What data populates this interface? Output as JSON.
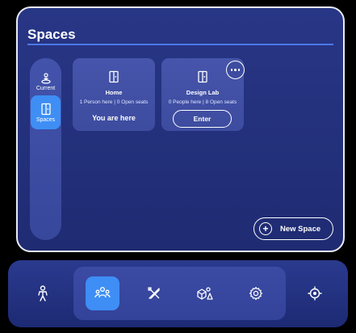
{
  "panel": {
    "title": "Spaces"
  },
  "rail": {
    "tabs": [
      {
        "label": "Current",
        "icon": "person-pin-icon",
        "selected": false
      },
      {
        "label": "Spaces",
        "icon": "door-icon",
        "selected": true
      }
    ]
  },
  "cards": [
    {
      "name": "Home",
      "occupancy": "1 Person here | 0 Open seats",
      "status": "You are here",
      "icon": "door-icon"
    },
    {
      "name": "Design Lab",
      "occupancy": "0 People here | 8 Open seats",
      "action": "Enter",
      "icon": "door-icon"
    }
  ],
  "new_space_label": "New Space",
  "dock": {
    "items": [
      {
        "icon": "avatar-icon",
        "active": false
      },
      {
        "icon": "people-icon",
        "active": true
      },
      {
        "icon": "design-tools-icon",
        "active": false
      },
      {
        "icon": "objects-icon",
        "active": false
      },
      {
        "icon": "gear-icon",
        "active": false
      },
      {
        "icon": "recenter-icon",
        "active": false
      }
    ]
  },
  "colors": {
    "accent": "#3e8ef5",
    "panel_bg": "#243180",
    "card_bg": "#4453a8"
  }
}
